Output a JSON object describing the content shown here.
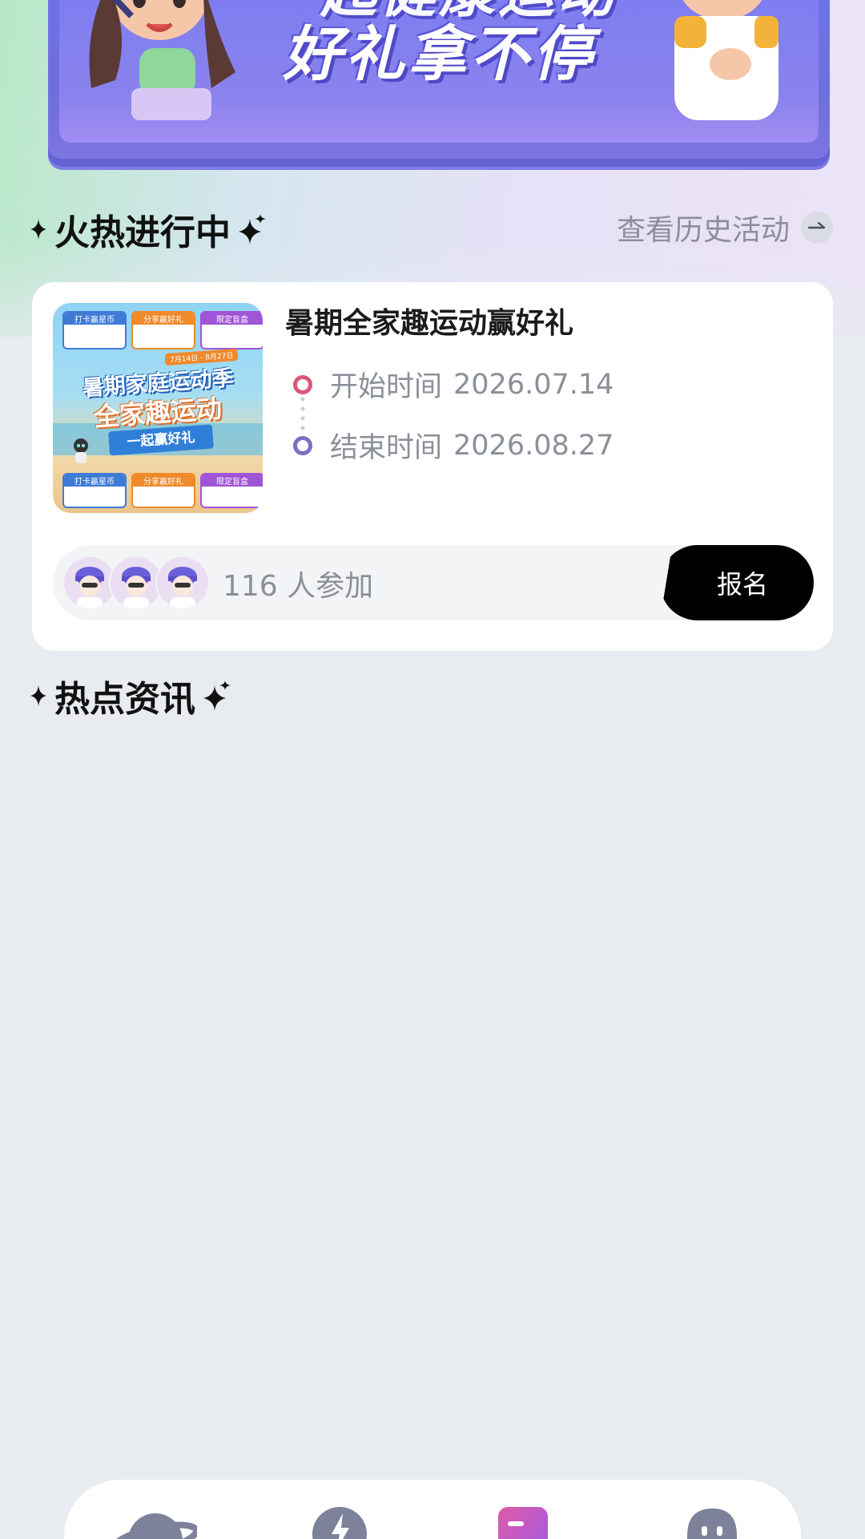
{
  "banner": {
    "line1": "一起健康运动",
    "line2": "好礼拿不停"
  },
  "hot_section": {
    "title": "火热进行中",
    "history_link": "查看历史活动"
  },
  "activity": {
    "title": "暑期全家趣运动赢好礼",
    "thumbnail": {
      "headline1": "暑期家庭运动季",
      "headline2": "全家趣运动",
      "ribbon": "一起赢好礼",
      "date_tag": "7月14日 - 8月27日",
      "top_chips": [
        "打卡赢星币",
        "分享赢好礼",
        "限定盲盒"
      ],
      "bottom_chips": [
        "打卡赢星币",
        "分享赢好礼",
        "限定盲盒"
      ]
    },
    "start_label": "开始时间",
    "start_date": "2026.07.14",
    "end_label": "结束时间",
    "end_date": "2026.08.27",
    "participants_text": "116 人参加",
    "signup_label": "报名"
  },
  "news_section": {
    "title": "热点资讯"
  },
  "colors": {
    "start_dot": "#d9587a",
    "end_dot": "#7a6fc2",
    "nav_icon": "#7d8199",
    "nav_active": "#c85ae0"
  },
  "bottom_nav": {
    "icons": [
      "planet-icon",
      "lightning-icon",
      "document-icon",
      "robot-icon"
    ]
  }
}
